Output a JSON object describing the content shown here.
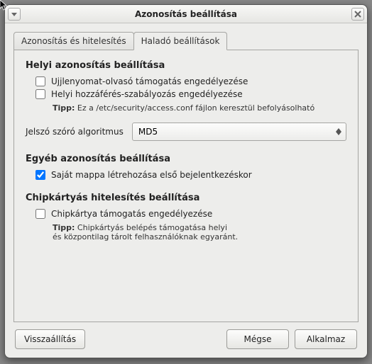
{
  "titlebar": {
    "title": "Azonosítás beállítása"
  },
  "tabs": {
    "auth": "Azonosítás és hitelesítés",
    "advanced": "Haladó beállítások"
  },
  "sections": {
    "local": {
      "title": "Helyi azonosítás beállítása",
      "fingerprint": "Ujjlenyomat-olvasó támogatás engedélyezése",
      "access": "Helyi hozzáférés-szabályozás engedélyezése",
      "tip_label": "Tipp:",
      "tip_text": "Ez a /etc/security/access.conf fájlon keresztül befolyásolható",
      "algo_label": "Jelszó szóró algoritmus",
      "algo_value": "MD5"
    },
    "other": {
      "title": "Egyéb azonosítás beállítása",
      "mkhome": "Saját mappa létrehozása első bejelentkezéskor"
    },
    "chip": {
      "title": "Chipkártyás hitelesítés beállítása",
      "enable": "Chipkártya támogatás engedélyezése",
      "tip_label": "Tipp:",
      "tip_line1": "Chipkártyás belépés támogatása helyi",
      "tip_line2": "és központilag tárolt felhasználóknak egyaránt."
    }
  },
  "buttons": {
    "reset": "Visszaállítás",
    "cancel": "Mégse",
    "apply": "Alkalmaz"
  },
  "checked": {
    "fingerprint": false,
    "access": false,
    "mkhome": true,
    "chip": false
  }
}
